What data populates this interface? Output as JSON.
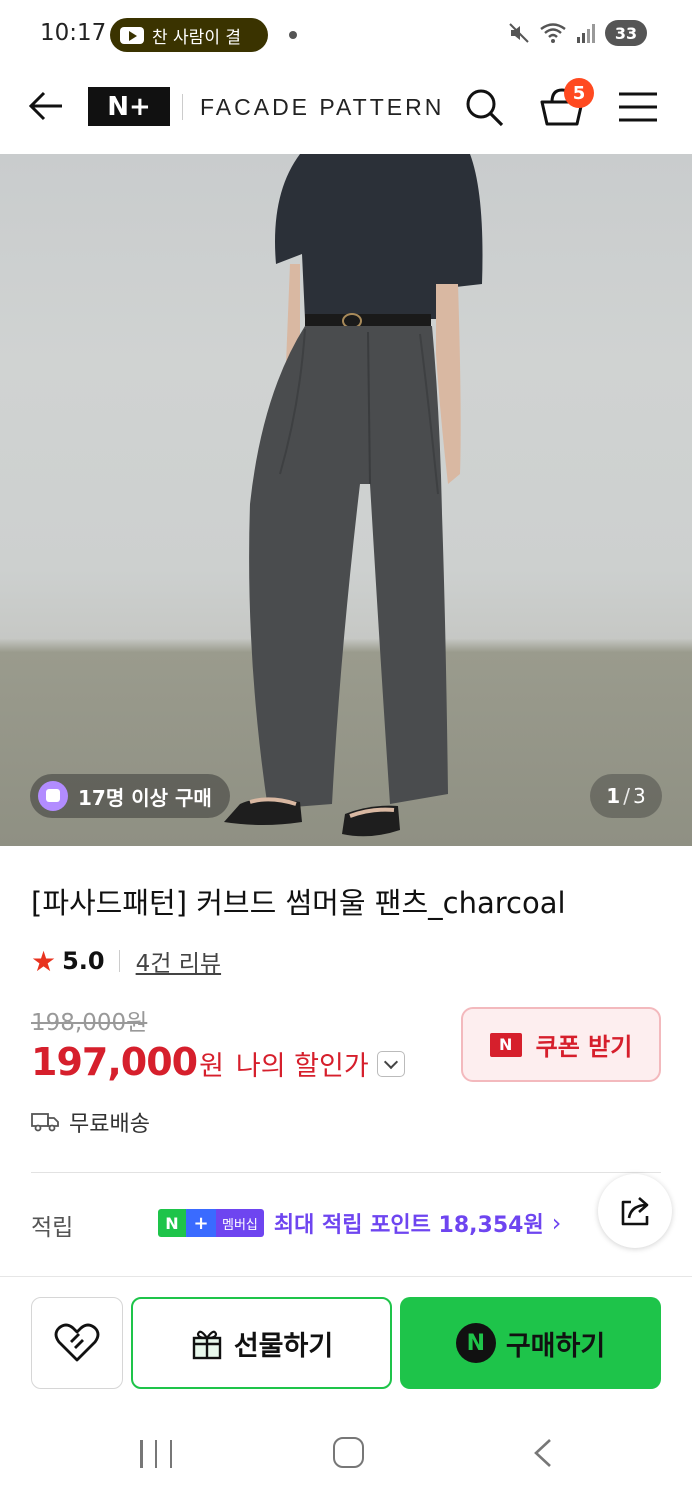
{
  "status_bar": {
    "time": "10:17",
    "notification_text": "찬 사람이 결",
    "battery": "33",
    "icons": [
      "youtube-icon",
      "mute-icon",
      "wifi-icon",
      "signal-icon"
    ]
  },
  "header": {
    "logo_text": "N+",
    "brand": "FACADE PATTERN",
    "cart_count": "5",
    "icons": [
      "back-arrow-icon",
      "search-icon",
      "cart-icon",
      "menu-icon"
    ]
  },
  "hero": {
    "buyers_badge": "17명 이상 구매",
    "page_current": "1",
    "page_total": "3"
  },
  "product": {
    "title": "[파사드패턴] 커브드 썸머울 팬츠_charcoal",
    "rating": "5.0",
    "review_link": "4건 리뷰",
    "original_price": "198,000원",
    "price": "197,000",
    "price_unit": "원",
    "my_price_label": "나의 할인가",
    "coupon_label": "쿠폰 받기",
    "coupon_badge": "N",
    "shipping": "무료배송"
  },
  "points": {
    "label": "적립",
    "badge_n": "N",
    "badge_plus": "+",
    "badge_member": "멤버십",
    "text": "최대 적립 포인트 18,354원"
  },
  "actions": {
    "gift_label": "선물하기",
    "buy_label": "구매하기",
    "buy_badge": "N"
  },
  "colors": {
    "brand_green": "#1ec44a",
    "price_red": "#d61f2c",
    "membership_purple": "#6e45f0",
    "cart_badge": "#ff4a20"
  }
}
